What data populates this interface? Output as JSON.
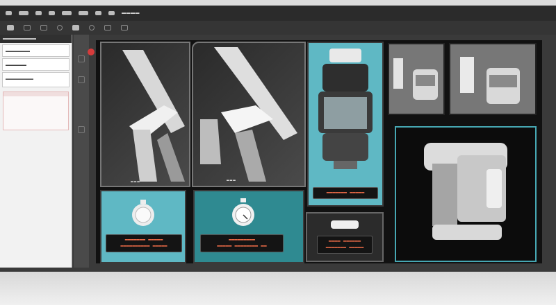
{
  "app": {
    "title": "▬▬▬▬",
    "menu_dots": 9
  },
  "left_panel": {
    "title": "▬▬▬▬▬▬▬▬",
    "items": [
      {
        "label": "▬▬▬▬▬▬▬"
      },
      {
        "label": "▬▬▬▬▬▬"
      },
      {
        "label": "▬▬▬▬▬▬▬▬"
      }
    ]
  },
  "canvas": {
    "panels": [
      {
        "id": "tool-1",
        "caption": "▬▬▬"
      },
      {
        "id": "tool-2",
        "caption": "▬▬▬"
      },
      {
        "id": "filter-cartridge",
        "label": "▬▬▬▬▬▬▬ ▬▬▬▬▬"
      },
      {
        "id": "pan-small",
        "label": ""
      },
      {
        "id": "pan-large",
        "label": ""
      },
      {
        "id": "stopwatch-1",
        "label": "▬▬▬▬▬▬▬ ▬▬▬▬▬\n▬▬▬▬▬▬▬▬▬▬ ▬▬▬▬▬"
      },
      {
        "id": "stopwatch-2",
        "label": "▬▬▬▬▬▬▬▬▬\n▬▬▬▬▬ ▬▬▬▬▬▬▬▬ ▬▬"
      },
      {
        "id": "connector",
        "label": "▬▬▬▬ ▬▬▬▬▬▬\n▬▬▬▬▬▬▬ ▬▬▬▬▬"
      },
      {
        "id": "device-housing",
        "label": ""
      }
    ]
  },
  "colors": {
    "accent_teal": "#5fb8c4",
    "label_red": "#e96a47",
    "alert_red": "#d63b3b"
  }
}
